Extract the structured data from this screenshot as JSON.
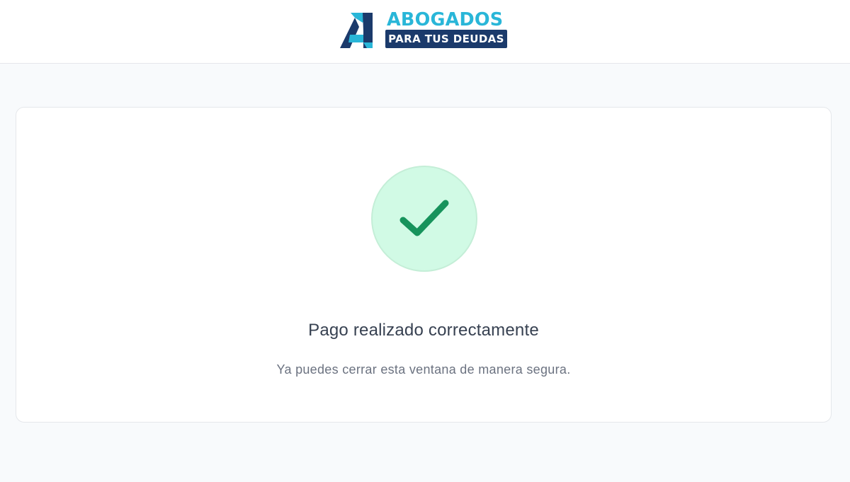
{
  "header": {
    "logo": {
      "line1": "ABOGADOS",
      "line2": "PARA TUS DEUDAS",
      "icon": "letter-a-logo-icon"
    }
  },
  "confirmation": {
    "icon": "check-icon",
    "title": "Pago realizado correctamente",
    "message": "Ya puedes cerrar esta ventana de manera segura."
  },
  "colors": {
    "brand_cyan": "#29b6d8",
    "brand_navy": "#1b3a6b",
    "success_circle": "#d1fae5",
    "success_check": "#17935c",
    "page_background": "#f8fafc"
  }
}
